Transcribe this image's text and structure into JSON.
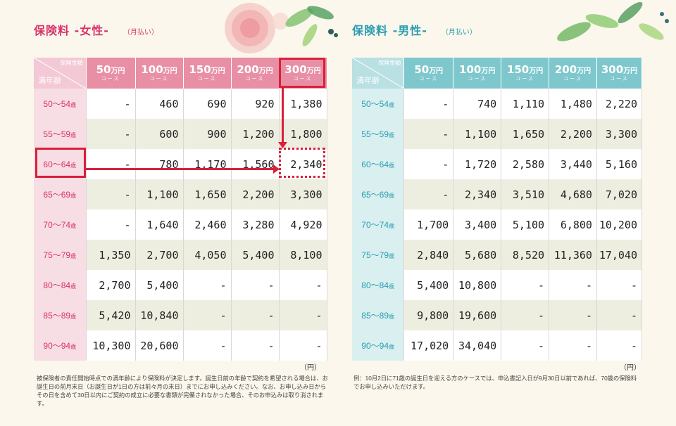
{
  "female": {
    "title": "保険料 -女性-",
    "subtitle": "（月払い）",
    "corner_top": "保険金額",
    "corner_bottom": "満年齢",
    "courses": [
      {
        "amount": "50",
        "unit": "万円",
        "label": "コース"
      },
      {
        "amount": "100",
        "unit": "万円",
        "label": "コース"
      },
      {
        "amount": "150",
        "unit": "万円",
        "label": "コース"
      },
      {
        "amount": "200",
        "unit": "万円",
        "label": "コース"
      },
      {
        "amount": "300",
        "unit": "万円",
        "label": "コース"
      }
    ],
    "age_suffix": "歳",
    "rows": [
      {
        "age": "50～54",
        "values": [
          "-",
          "460",
          "690",
          "920",
          "1,380"
        ]
      },
      {
        "age": "55～59",
        "values": [
          "-",
          "600",
          "900",
          "1,200",
          "1,800"
        ]
      },
      {
        "age": "60～64",
        "values": [
          "-",
          "780",
          "1,170",
          "1,560",
          "2,340"
        ]
      },
      {
        "age": "65～69",
        "values": [
          "-",
          "1,100",
          "1,650",
          "2,200",
          "3,300"
        ]
      },
      {
        "age": "70～74",
        "values": [
          "-",
          "1,640",
          "2,460",
          "3,280",
          "4,920"
        ]
      },
      {
        "age": "75～79",
        "values": [
          "1,350",
          "2,700",
          "4,050",
          "5,400",
          "8,100"
        ]
      },
      {
        "age": "80～84",
        "values": [
          "2,700",
          "5,400",
          "-",
          "-",
          "-"
        ]
      },
      {
        "age": "85～89",
        "values": [
          "5,420",
          "10,840",
          "-",
          "-",
          "-"
        ]
      },
      {
        "age": "90～94",
        "values": [
          "10,300",
          "20,600",
          "-",
          "-",
          "-"
        ]
      }
    ],
    "unit": "（円）",
    "note": "被保険者の責任開始時点での満年齢により保険料が決定します。誕生日前の年齢で契約を希望される場合は、お誕生日の前月末日（お誕生日が1日の方は前々月の末日）までにお申し込みください。なお、お申し込み日からその日を含めて30日以内にご契約の成立に必要な書類が完備されなかった場合、そのお申込みは取り消されます。"
  },
  "male": {
    "title": "保険料 -男性-",
    "subtitle": "（月払い）",
    "corner_top": "保険金額",
    "corner_bottom": "満年齢",
    "courses": [
      {
        "amount": "50",
        "unit": "万円",
        "label": "コース"
      },
      {
        "amount": "100",
        "unit": "万円",
        "label": "コース"
      },
      {
        "amount": "150",
        "unit": "万円",
        "label": "コース"
      },
      {
        "amount": "200",
        "unit": "万円",
        "label": "コース"
      },
      {
        "amount": "300",
        "unit": "万円",
        "label": "コース"
      }
    ],
    "age_suffix": "歳",
    "rows": [
      {
        "age": "50～54",
        "values": [
          "-",
          "740",
          "1,110",
          "1,480",
          "2,220"
        ]
      },
      {
        "age": "55～59",
        "values": [
          "-",
          "1,100",
          "1,650",
          "2,200",
          "3,300"
        ]
      },
      {
        "age": "60～64",
        "values": [
          "-",
          "1,720",
          "2,580",
          "3,440",
          "5,160"
        ]
      },
      {
        "age": "65～69",
        "values": [
          "-",
          "2,340",
          "3,510",
          "4,680",
          "7,020"
        ]
      },
      {
        "age": "70～74",
        "values": [
          "1,700",
          "3,400",
          "5,100",
          "6,800",
          "10,200"
        ]
      },
      {
        "age": "75～79",
        "values": [
          "2,840",
          "5,680",
          "8,520",
          "11,360",
          "17,040"
        ]
      },
      {
        "age": "80～84",
        "values": [
          "5,400",
          "10,800",
          "-",
          "-",
          "-"
        ]
      },
      {
        "age": "85～89",
        "values": [
          "9,800",
          "19,600",
          "-",
          "-",
          "-"
        ]
      },
      {
        "age": "90～94",
        "values": [
          "17,020",
          "34,040",
          "-",
          "-",
          "-"
        ]
      }
    ],
    "unit": "（円）",
    "note": "例：10月2日に71歳の誕生日を迎える方のケースでは、申込書記入日が9月30日以前であれば、70歳の保険料でお申し込みいただけます。"
  },
  "colors": {
    "female_accent": "#d8336b",
    "female_header": "#e88fa6",
    "male_accent": "#2a9db0",
    "male_header": "#7ec7cd",
    "highlight": "#d8203a"
  }
}
